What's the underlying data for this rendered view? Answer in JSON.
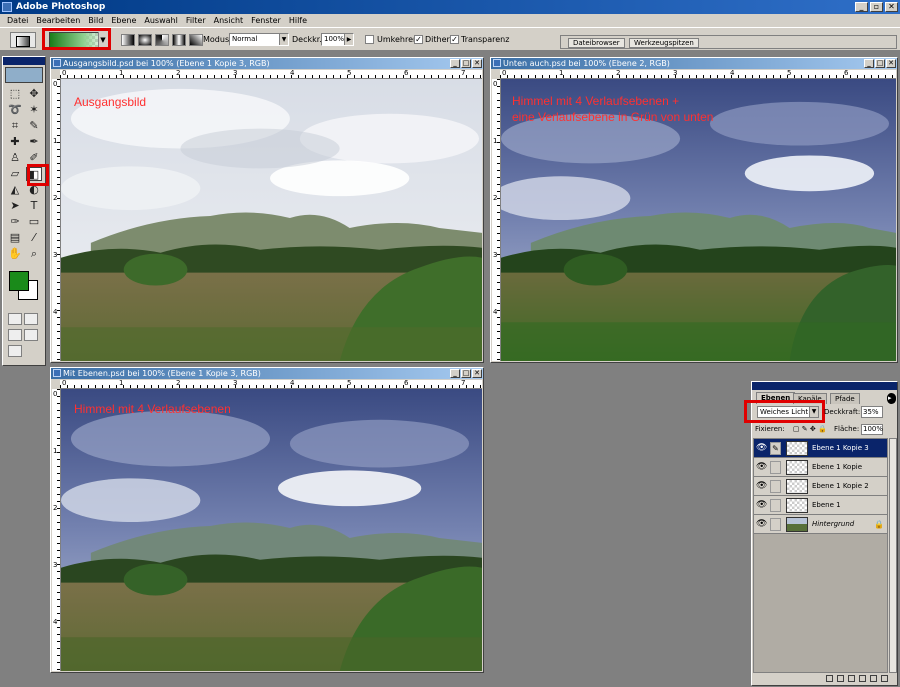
{
  "app": {
    "title": "Adobe Photoshop"
  },
  "menu": [
    "Datei",
    "Bearbeiten",
    "Bild",
    "Ebene",
    "Auswahl",
    "Filter",
    "Ansicht",
    "Fenster",
    "Hilfe"
  ],
  "options": {
    "modus_label": "Modus:",
    "modus_value": "Normal",
    "deckkraft_label": "Deckkr.:",
    "deckkraft_value": "100%",
    "umkehren_label": "Umkehren",
    "dither_label": "Dither",
    "transparenz_label": "Transparenz",
    "umkehren_checked": false,
    "dither_checked": true,
    "transparenz_checked": true
  },
  "wells": {
    "tab1": "Dateibrowser",
    "tab2": "Werkzeugspitzen"
  },
  "colors": {
    "foreground": "#1a8a1a",
    "background": "#ffffff",
    "highlight": "#e00000"
  },
  "documents": {
    "doc1": {
      "title": "Ausgangsbild.psd bei 100% (Ebene 1 Kopie 3, RGB)",
      "label": "Ausgangsbild"
    },
    "doc2": {
      "title": "Unten auch.psd bei 100% (Ebene 2, RGB)",
      "label_line1": "Himmel mit 4 Verlaufsebenen +",
      "label_line2": "eine Verlaufsebene in Grün von unten"
    },
    "doc3": {
      "title": "Mit Ebenen.psd bei 100% (Ebene 1 Kopie 3, RGB)",
      "label": "Himmel mit 4 Verlaufsebenen"
    }
  },
  "layers_panel": {
    "tabs": [
      "Ebenen",
      "Kanäle",
      "Pfade"
    ],
    "blend_mode": "Weiches Licht",
    "opacity_label": "Deckkraft:",
    "opacity_value": "35%",
    "fix_label": "Fixieren:",
    "fill_label": "Fläche:",
    "fill_value": "100%",
    "layers": [
      {
        "name": "Ebene 1 Kopie 3",
        "selected": true
      },
      {
        "name": "Ebene 1 Kopie",
        "selected": false
      },
      {
        "name": "Ebene 1 Kopie 2",
        "selected": false
      },
      {
        "name": "Ebene 1",
        "selected": false
      },
      {
        "name": "Hintergrund",
        "selected": false
      }
    ]
  }
}
